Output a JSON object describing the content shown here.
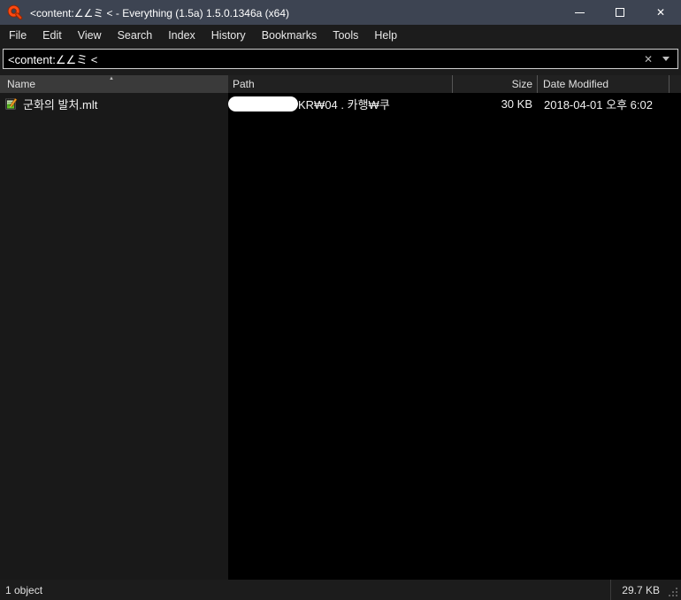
{
  "window": {
    "title": "<content:∠∠ミ <  - Everything (1.5a) 1.5.0.1346a (x64)"
  },
  "icons": {
    "app_logo": "magnifier",
    "close": "✕",
    "clear": "✕",
    "dropdown": "chevron-down",
    "sort_ascending": "▲",
    "file_type": "mlt-notepad"
  },
  "menu": {
    "items": [
      "File",
      "Edit",
      "View",
      "Search",
      "Index",
      "History",
      "Bookmarks",
      "Tools",
      "Help"
    ]
  },
  "search": {
    "value": "<content:∠∠ミ <"
  },
  "columns": {
    "name": "Name",
    "path": "Path",
    "size": "Size",
    "date_modified": "Date Modified"
  },
  "rows": [
    {
      "name": "군화의 발처.mlt",
      "path_visible": "KR₩04 . 카행₩쿠",
      "size": "30 KB",
      "date_modified": "2018-04-01 오후 6:02"
    }
  ],
  "status": {
    "object_count": "1 object",
    "total_size": "29.7 KB"
  },
  "colors": {
    "titlebar": "#3d4452",
    "chrome": "#1c1c1c",
    "header_sorted": "#3a3a3a",
    "header": "#212121",
    "name_column_bg": "#191919",
    "list_bg": "#000000",
    "logo_orange": "#ff4a12"
  }
}
